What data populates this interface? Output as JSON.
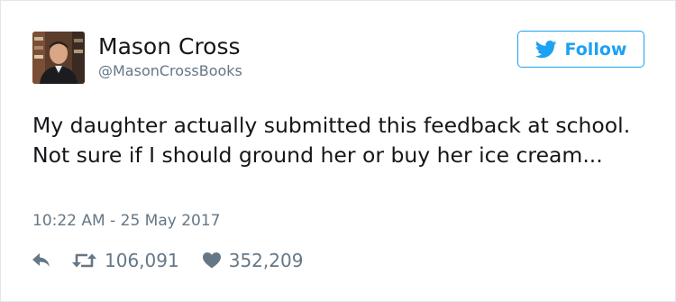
{
  "tweet": {
    "author_name": "Mason Cross",
    "author_handle": "@MasonCrossBooks",
    "follow_label": "Follow",
    "text": "My daughter actually submitted this feedback at school. Not sure if I should ground her or buy her ice cream...",
    "timestamp": "10:22 AM - 25 May 2017",
    "retweet_count": "106,091",
    "like_count": "352,209"
  },
  "icons": {
    "follow": "twitter-bird-icon",
    "reply": "reply-icon",
    "retweet": "retweet-icon",
    "like": "heart-icon"
  },
  "colors": {
    "accent": "#1da1f2",
    "text": "#14171a",
    "muted": "#657786",
    "border": "#e1e8ed"
  }
}
